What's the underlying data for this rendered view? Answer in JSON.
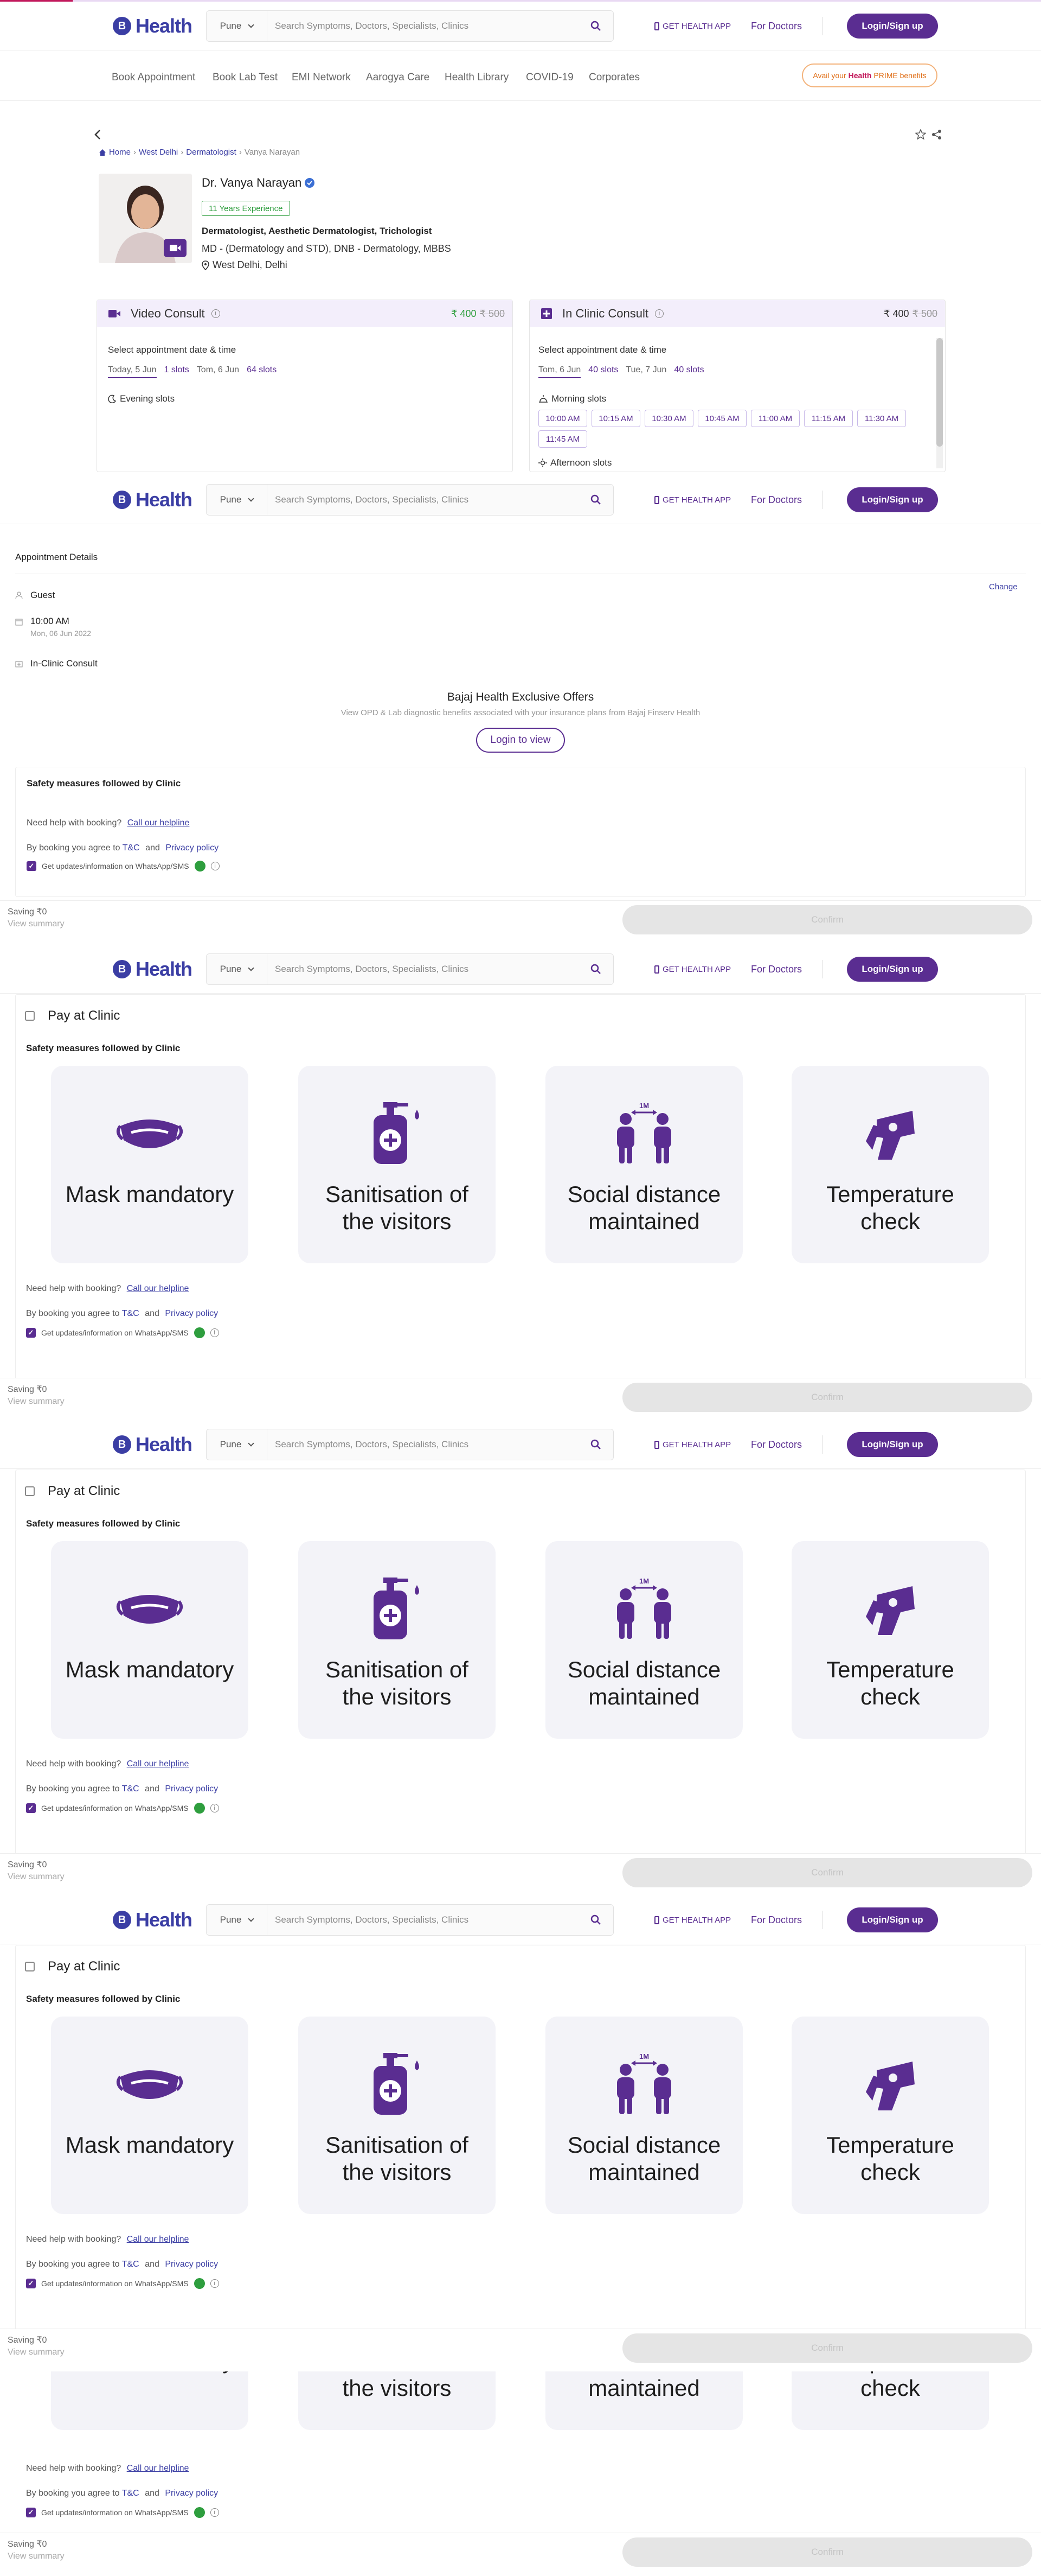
{
  "header": {
    "logo_text": "Health",
    "logo_letter": "B",
    "city": "Pune",
    "search_placeholder": "Search Symptoms, Doctors, Specialists, Clinics",
    "get_app": "GET HEALTH APP",
    "for_doctors": "For Doctors",
    "login": "Login/Sign up"
  },
  "nav": {
    "items": [
      "Book Appointment",
      "Book Lab Test",
      "EMI Network",
      "Aarogya Care",
      "Health Library",
      "COVID-19",
      "Corporates"
    ],
    "prime_prefix": "Avail your",
    "prime_brand": "Health",
    "prime_suffix": "PRIME benefits"
  },
  "breadcrumb": {
    "home": "Home",
    "city": "West Delhi",
    "specialty": "Dermatologist",
    "current": "Vanya Narayan",
    "sep": "›"
  },
  "doctor": {
    "name": "Dr. Vanya Narayan",
    "experience": "11 Years Experience",
    "specialties": "Dermatologist, Aesthetic Dermatologist, Trichologist",
    "qualifications": "MD - (Dermatology and STD), DNB - Dermatology, MBBS",
    "location": "West Delhi, Delhi"
  },
  "video_consult": {
    "title": "Video Consult",
    "price": "₹ 400",
    "old_price": "₹ 500",
    "select_label": "Select appointment date & time",
    "dates": [
      {
        "label": "Today, 5 Jun"
      },
      {
        "label": "1 slots"
      },
      {
        "label": "Tom, 6 Jun"
      },
      {
        "label": "64 slots"
      }
    ],
    "evening": "Evening slots"
  },
  "clinic_consult": {
    "title": "In Clinic Consult",
    "price": "₹ 400",
    "old_price": "₹ 500",
    "select_label": "Select appointment date & time",
    "dates": [
      {
        "label": "Tom, 6 Jun"
      },
      {
        "label": "40 slots"
      },
      {
        "label": "Tue, 7 Jun"
      },
      {
        "label": "40 slots"
      }
    ],
    "morning": "Morning slots",
    "afternoon": "Afternoon slots",
    "morning_slots": [
      "10:00 AM",
      "10:15 AM",
      "10:30 AM",
      "10:45 AM",
      "11:00 AM",
      "11:15 AM",
      "11:30 AM",
      "11:45 AM"
    ]
  },
  "appointment": {
    "title": "Appointment Details",
    "change": "Change",
    "patient": "Guest",
    "time": "10:00 AM",
    "date": "Mon, 06 Jun 2022",
    "type": "In-Clinic Consult"
  },
  "offers": {
    "title": "Bajaj Health Exclusive Offers",
    "subtitle": "View OPD & Lab diagnostic benefits associated with your insurance plans from Bajaj Finserv Health",
    "button": "Login to view"
  },
  "footer_info": {
    "safety_title": "Safety measures followed by Clinic",
    "help_text": "Need help with booking?",
    "helpline": "Call our helpline",
    "agree_text": "By booking you agree to",
    "tnc": "T&C",
    "and": "and",
    "privacy": "Privacy policy",
    "updates": "Get updates/information on WhatsApp/SMS",
    "info_mark": "i"
  },
  "bottom_bar": {
    "saving": "Saving ₹0",
    "view_summary": "View summary",
    "confirm": "Confirm"
  },
  "pay_at_clinic": "Pay at Clinic",
  "safety_tiles": [
    {
      "label": "Mask mandatory",
      "icon": "mask-icon"
    },
    {
      "label": "Sanitisation of the visitors",
      "icon": "sanitizer-icon"
    },
    {
      "label": "Social distance maintained",
      "icon": "social-distance-icon"
    },
    {
      "label": "Temperature check",
      "icon": "thermometer-icon"
    }
  ],
  "distance_label": "1M",
  "colors": {
    "brand": "#5a2d91",
    "logo": "#3b3ea4",
    "green": "#2e9e3e",
    "orange": "#e0701a"
  }
}
